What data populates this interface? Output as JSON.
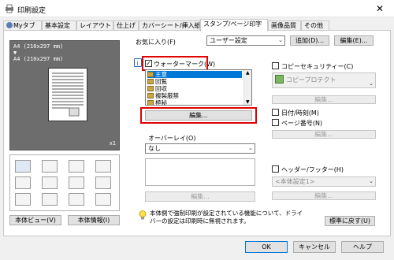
{
  "window": {
    "title": "印刷設定",
    "close_glyph": "✕"
  },
  "tabs": [
    {
      "label": "Myタブ"
    },
    {
      "label": "基本設定"
    },
    {
      "label": "レイアウト"
    },
    {
      "label": "仕上げ"
    },
    {
      "label": "カバーシート/挿入紙"
    },
    {
      "label": "スタンプ/ページ印字"
    },
    {
      "label": "画像品質"
    },
    {
      "label": "その他"
    }
  ],
  "active_tab": "スタンプ/ページ印字",
  "preview": {
    "size_line1": "A4 (210x297 mm)",
    "arrow": "▼",
    "size_line2": "A4 (210x297 mm)",
    "copies": "x1"
  },
  "left_buttons": {
    "printer_view": "本体ビュー(V)",
    "printer_info": "本体情報(I)"
  },
  "favorites": {
    "label": "お気に入り(F)",
    "value": "ユーザー設定",
    "add_button": "追加(D)...",
    "edit_button": "編集(E)..."
  },
  "watermark": {
    "label": "ウォーターマーク(W)",
    "checked": true,
    "items": [
      {
        "label": "主意",
        "selected": true
      },
      {
        "label": "回覧",
        "selected": false
      },
      {
        "label": "回収",
        "selected": false
      },
      {
        "label": "複製厳禁",
        "selected": false
      },
      {
        "label": "極秘",
        "selected": false
      }
    ],
    "edit_button": "編集..."
  },
  "overlay": {
    "label": "オーバーレイ(O)",
    "value": "なし",
    "edit_button": "編集..."
  },
  "copy_security": {
    "label": "コピーセキュリティー(C)",
    "checked": false,
    "value": "コピープロテクト",
    "edit_button": "編集..."
  },
  "datetime": {
    "label": "日付/時刻(M)",
    "checked": false
  },
  "page_number": {
    "label": "ページ番号(N)",
    "checked": false,
    "edit_button": "編集..."
  },
  "header_footer": {
    "label": "ヘッダー/フッター(H)",
    "checked": false,
    "value": "<本体設定1>",
    "edit_button": "編集..."
  },
  "notice": "本体側で強制印刷が設定されている機能について、ドライバーの設定は印刷時に無視されます。",
  "restore_button": "標準に戻す(U)",
  "footer_buttons": {
    "ok": "OK",
    "cancel": "キャンセル",
    "help": "ヘルプ"
  },
  "colors": {
    "highlight": "#0078d7",
    "red_outline": "#e00000",
    "preview_bg": "#6d6d6d"
  }
}
